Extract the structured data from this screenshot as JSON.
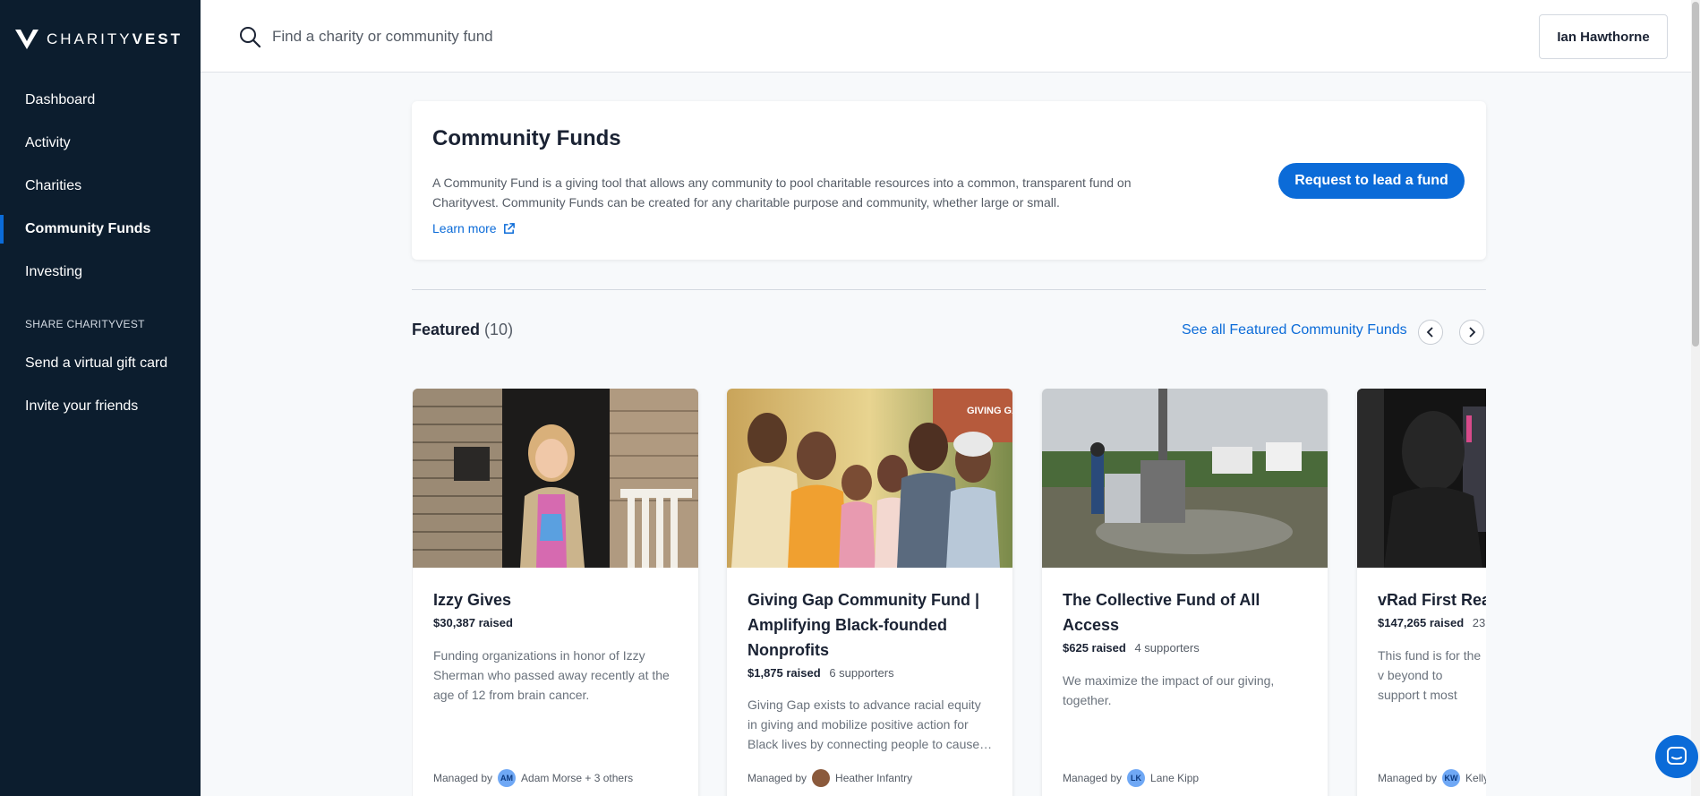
{
  "brand": {
    "name_light": "CHARITY",
    "name_bold": "VEST"
  },
  "sidebar": {
    "items": [
      {
        "label": "Dashboard"
      },
      {
        "label": "Activity"
      },
      {
        "label": "Charities"
      },
      {
        "label": "Community Funds"
      },
      {
        "label": "Investing"
      }
    ],
    "section_label": "SHARE CHARITYVEST",
    "share_items": [
      {
        "label": "Send a virtual gift card"
      },
      {
        "label": "Invite your friends"
      }
    ]
  },
  "search": {
    "placeholder": "Find a charity or community fund"
  },
  "user": {
    "name": "Ian Hawthorne"
  },
  "intro": {
    "title": "Community Funds",
    "description": "A Community Fund is a giving tool that allows any community to pool charitable resources into a common, transparent fund on Charityvest. Community Funds can be created for any charitable purpose and community, whether large or small.",
    "learn_more": "Learn more",
    "cta": "Request to lead a fund"
  },
  "featured": {
    "title": "Featured",
    "count": "(10)",
    "see_all": "See all Featured Community Funds"
  },
  "cards": [
    {
      "title": "Izzy Gives",
      "raised": "$30,387 raised",
      "supporters": "",
      "description": "Funding organizations in honor of Izzy Sherman who passed away recently at the age of 12 from brain cancer.",
      "managed_label": "Managed by",
      "manager_initials": "AM",
      "manager": "Adam Morse + 3 others"
    },
    {
      "title": "Giving Gap Community Fund | Amplifying Black-founded Nonprofits",
      "raised": "$1,875 raised",
      "supporters": "6 supporters",
      "description": "Giving Gap exists to advance racial equity in giving and mobilize positive action for Black lives by connecting people to cause…",
      "managed_label": "Managed by",
      "manager_initials": "",
      "manager": "Heather Infantry",
      "image_badge": "GIVING GAP"
    },
    {
      "title": "The Collective Fund of All Access",
      "raised": "$625 raised",
      "supporters": "4 supporters",
      "description": "We maximize the impact of our giving, together.",
      "managed_label": "Managed by",
      "manager_initials": "LK",
      "manager": "Lane Kipp"
    },
    {
      "title": "vRad First Rea",
      "raised": "$147,265 raised",
      "supporters": "23",
      "description": "This fund is for the v beyond to support t most about.",
      "managed_label": "Managed by",
      "manager_initials": "KW",
      "manager": "Kelly"
    }
  ],
  "colors": {
    "sidebar": "#0c1d2e",
    "accent": "#0b6bd8"
  }
}
